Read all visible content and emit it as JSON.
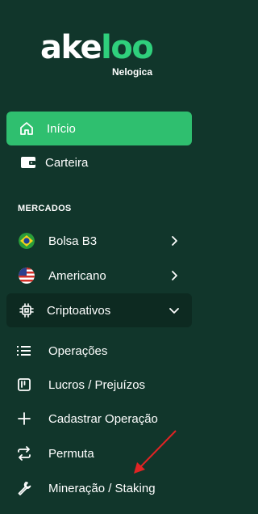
{
  "brand": {
    "logo_part1": "ake",
    "logo_part2": "loo",
    "subtitle": "Nelogica"
  },
  "nav": {
    "inicio": "Início",
    "carteira": "Carteira"
  },
  "section_mercados": "MERCADOS",
  "markets": {
    "bolsa": "Bolsa B3",
    "americano": "Americano",
    "cripto": "Criptoativos"
  },
  "crypto_submenu": {
    "operacoes": "Operações",
    "lucros": "Lucros / Prejuízos",
    "cadastrar": "Cadastrar Operação",
    "permuta": "Permuta",
    "mineracao": "Mineração / Staking"
  },
  "colors": {
    "sidebar_bg": "#11362b",
    "active_bg": "#2fbf6f",
    "brand_green": "#2fd07c",
    "annotation_arrow": "#e02424"
  },
  "icons": [
    "home-icon",
    "wallet-icon",
    "brazil-flag-icon",
    "usa-flag-icon",
    "chip-icon",
    "chevron-right-icon",
    "chevron-down-icon",
    "list-icon",
    "kanban-icon",
    "plus-icon",
    "swap-icon",
    "wrench-icon"
  ]
}
